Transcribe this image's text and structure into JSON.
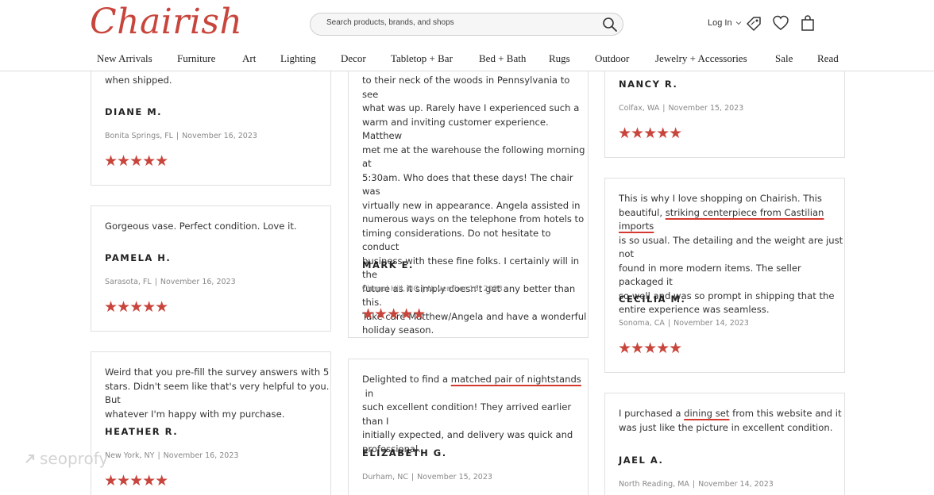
{
  "header": {
    "logo": "Chairish",
    "search_placeholder": "Search products, brands, and shops",
    "login_label": "Log In",
    "icons": [
      "search-icon",
      "tag-icon",
      "heart-icon",
      "shopping-bag-icon",
      "chevron-down-icon"
    ]
  },
  "nav": [
    "New Arrivals",
    "Furniture",
    "Art",
    "Lighting",
    "Decor",
    "Tabletop + Bar",
    "Bed + Bath",
    "Rugs",
    "Outdoor",
    "Jewelry + Accessories",
    "Sale",
    "Read"
  ],
  "reviews": {
    "diane": {
      "text_end": "when shipped.",
      "name": "DIANE M.",
      "location": "Bonita Springs, FL",
      "date": "November 16, 2023",
      "stars": "★★★★★",
      "rating": 5
    },
    "pamela": {
      "text": "Gorgeous vase. Perfect condition. Love it.",
      "name": "PAMELA H.",
      "location": "Sarasota, FL",
      "date": "November 16, 2023",
      "stars": "★★★★★",
      "rating": 5
    },
    "heather": {
      "lines": [
        "Weird that you pre-fill the survey answers with 5",
        "stars. Didn't seem like that's very helpful to you. But",
        "whatever I'm happy with my purchase."
      ],
      "name": "HEATHER R.",
      "location": "New York, NY",
      "date": "November 16, 2023",
      "stars": "★★★★★",
      "rating": 5
    },
    "mark": {
      "lines": [
        "to their neck of the woods in Pennsylvania to see",
        "what was up. Rarely have I experienced such a",
        "warm and inviting customer experience. Matthew",
        "met me at the warehouse the following morning at",
        "5:30am. Who does that these days! The chair was",
        "virtually new in appearance. Angela assisted in",
        "numerous ways on the telephone from hotels to",
        "timing considerations. Do not hesitate to conduct",
        "business with these fine folks. I certainly will in the",
        "future as it simply doesn't get any better than this.",
        "Take care Matthew/Angela and have a wonderful",
        "holiday season."
      ],
      "name": "MARK E.",
      "location": "Chapel Hill, NC",
      "date": "November 16, 2023",
      "stars": "★★★★★",
      "rating": 5
    },
    "elizabeth": {
      "l1_pre": "Delighted to find a ",
      "l1_hl": "matched pair of nightstands",
      "l1_post": " in",
      "lines": [
        "such excellent condition! They arrived earlier than I",
        "initially expected, and delivery was quick and",
        "professional."
      ],
      "name": "ELIZABETH G.",
      "location": "Durham, NC",
      "date": "November 15, 2023"
    },
    "nancy": {
      "name": "NANCY R.",
      "location": "Colfax, WA",
      "date": "November 15, 2023",
      "stars": "★★★★★",
      "rating": 5
    },
    "cecilia": {
      "l1": "This is why I love shopping on Chairish. This",
      "l2_pre": "beautiful, ",
      "l2_hl": "striking centerpiece from Castilian imports",
      "lines": [
        "is so usual. The detailing and the weight are just not",
        "found in more modern items. The seller packaged it",
        "so well and was so prompt in shipping that the",
        "entire experience was seamless."
      ],
      "name": "CECILIA M.",
      "location": "Sonoma, CA",
      "date": "November 14, 2023",
      "stars": "★★★★★",
      "rating": 5
    },
    "jael": {
      "l1_pre": "I purchased a ",
      "l1_hl": "dining set",
      "l1_post": " from this website and it",
      "l2": "was just like the picture in excellent condition.",
      "name": "JAEL A.",
      "location": "North Reading, MA",
      "date": "November 14, 2023"
    }
  },
  "separator": "|",
  "watermark": "seoprofy",
  "colors": {
    "brand": "#c8453c",
    "highlight_underline": "#d43a30",
    "border": "#e0e0e0",
    "meta_text": "#888888"
  }
}
